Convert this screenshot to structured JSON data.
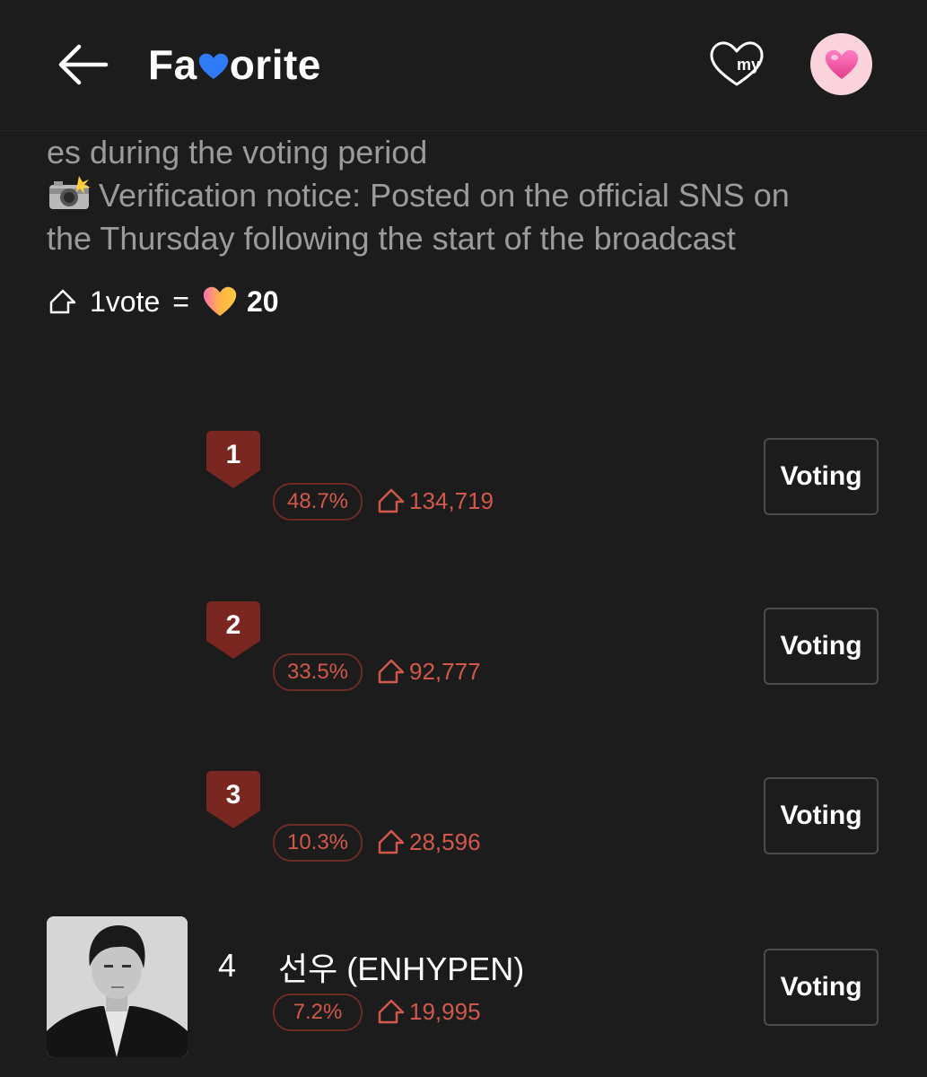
{
  "header": {
    "back_icon": "arrow-left-icon",
    "logo_prefix": "Fa",
    "logo_suffix": "orite",
    "logo_heart_color": "#2f7bf5",
    "my_label": "my",
    "my_icon": "heart-outline-icon",
    "profile_icon": "pink-heart-icon"
  },
  "notice": {
    "line1": "es during the voting period",
    "line2": "Verification notice: Posted on the official SNS on",
    "line3": "the Thursday following the start of the broadcast",
    "camera_icon": "camera-flash-icon"
  },
  "rate": {
    "vote_label": "1vote",
    "equals": "=",
    "amount": "20"
  },
  "colors": {
    "background": "#1c1c1c",
    "accent_red": "#d2584b",
    "badge_red": "#7a2621",
    "muted_text": "#9b9b9b"
  },
  "ranking": [
    {
      "rank": "1",
      "name": "",
      "percent": "48.7%",
      "votes": "134,719",
      "button": "Voting"
    },
    {
      "rank": "2",
      "name": "",
      "percent": "33.5%",
      "votes": "92,777",
      "button": "Voting"
    },
    {
      "rank": "3",
      "name": "",
      "percent": "10.3%",
      "votes": "28,596",
      "button": "Voting"
    },
    {
      "rank": "4",
      "name": "선우 (ENHYPEN)",
      "percent": "7.2%",
      "votes": "19,995",
      "button": "Voting"
    }
  ]
}
